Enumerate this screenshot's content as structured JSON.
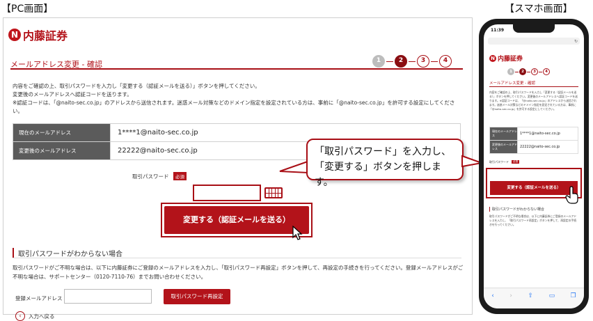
{
  "captions": {
    "pc": "【PC画面】",
    "phone": "【スマホ画面】"
  },
  "brand": {
    "logo_mark": "N",
    "logo_text": "内藤証券",
    "accent": "#b3131a"
  },
  "page_title": "メールアドレス変更 - 確認",
  "steps": [
    {
      "label": "1",
      "state": "done"
    },
    {
      "label": "2",
      "state": "current"
    },
    {
      "label": "3",
      "state": "todo"
    },
    {
      "label": "4",
      "state": "todo"
    }
  ],
  "description": [
    "内容をご確認の上、取引パスワードを入力し「変更する（認証メールを送る）」ボタンを押してください。",
    "変更後のメールアドレスへ認証コードを送ります。",
    "※認証コードは、「@naito-sec.co.jp」のアドレスから送信されます。迷惑メール対策などのドメイン指定を設定されている方は、事前に「@naito-sec.co.jp」を許可する設定にしてください。"
  ],
  "table": [
    {
      "label": "現在のメールアドレス",
      "value": "1****1@naito-sec.co.jp"
    },
    {
      "label": "変更後のメールアドレス",
      "value": "22222@naito-sec.co.jp"
    }
  ],
  "password": {
    "label": "取引パスワード",
    "required_badge": "必須",
    "value": ""
  },
  "submit_label": "変更する（認証メールを送る）",
  "callout": {
    "line1": "「取引パスワード」を入力し、",
    "line2": "「変更する」ボタンを押します。"
  },
  "forgot": {
    "heading": "取引パスワードがわからない場合",
    "text": "取引パスワードがご不明な場合は、以下に内藤証券にご登録のメールアドレスを入力し、「取引パスワード再設定」ボタンを押して、再設定の手続きを行ってください。登録メールアドレスがご不明な場合は、サポートセンター（0120-7110-76）までお問い合わせください。",
    "email_label": "登録メールアドレス",
    "email_value": "",
    "reset_label": "取引パスワード再設定"
  },
  "back_label": "入力へ戻る",
  "phone": {
    "time": "11:39",
    "title": "メールアドレス変更 - 確認",
    "desc": "内容をご確認の上、取引パスワードを入力し「変更する（認証メールを送る）」ボタンを押してください。変更後のメールアドレスへ認証コードを送ります。※認証コードは、「@naito-sec.co.jp」のアドレスから送信されます。迷惑メール対策などのドメイン指定を設定されている方は、事前に「@naito-sec.co.jp」を許可する設定にしてください。",
    "table": [
      {
        "label": "現在のメールアドレス",
        "value": "1****1@naito-sec.co.jp"
      },
      {
        "label": "変更後のメールアドレス",
        "value": "22222@naito-sec.co.jp"
      }
    ],
    "pw_label": "取引パスワード",
    "required_badge": "必須",
    "submit_label": "変更する（認証メールを送る）",
    "forgot_heading": "取引パスワードがわからない場合",
    "forgot_text": "取引パスワードがご不明な場合は、以下に内藤証券にご登録のメールアドレスを入力し、「取引パスワード再設定」ボタンを押して、再設定の手続きを行ってください。"
  }
}
